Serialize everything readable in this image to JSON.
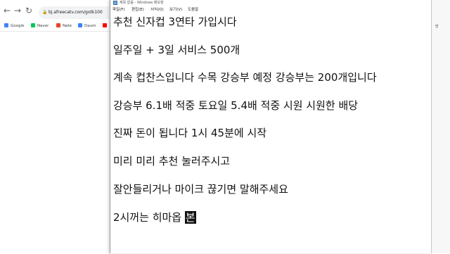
{
  "browser": {
    "url": "bj.afreecatv.com/gotk100",
    "bookmarks": [
      {
        "label": "Google",
        "color": "#4285f4"
      },
      {
        "label": "Naver",
        "color": "#03c75a"
      },
      {
        "label": "Nate",
        "color": "#e8452c"
      },
      {
        "label": "Daum",
        "color": "#3b82f6"
      }
    ],
    "right_panel_text": "방"
  },
  "notepad": {
    "title": "제목 없음 - Windows 메모장",
    "menu": [
      "파일(F)",
      "편집(E)",
      "서식(O)",
      "보기(V)",
      "도움말"
    ],
    "lines": [
      "추천 신자컵 3연타 가입시다",
      "일주일 + 3일 서비스 500개",
      "계속 컵찬스입니다 수목 강승부 예정 강승부는 200개입니다",
      "강승부 6.1배 적중 토요일 5.4배 적중 시원 시원한 배당",
      "진짜 돈이 됩니다 1시 45분에 시작",
      "미리 미리 추천 눌러주시고",
      "잘안들리거나 마이크 끊기면 말해주세요",
      "2시꺼는 히마옵"
    ],
    "cursor_char": "본"
  }
}
